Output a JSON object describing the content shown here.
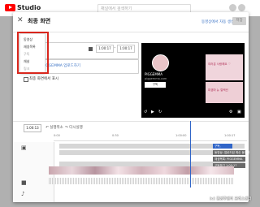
{
  "app": {
    "studio_label": "Studio",
    "search_placeholder": "채널에서 검색하기"
  },
  "modal": {
    "title": "최종 화면",
    "link_label": "동영상에서 자동 생성",
    "save_label": "저장"
  },
  "editor": {
    "row_number": "21",
    "start_time": "1:00:17",
    "end_time": "1:00:17",
    "caption_placeholder": "구독, PIGGEMMA 업로드하기",
    "checkbox_label": "최종 화면에서 표시"
  },
  "dropdown": {
    "items": [
      "동영상",
      "재생목록",
      "구독",
      "채널",
      "링크"
    ]
  },
  "preview": {
    "channel_name": "PIGGEMMA",
    "channel_sub": "piggemma.com",
    "subscribe": "구독",
    "thumb1_title": "여러분 사랑해요 ♡",
    "thumb2_title": "피겜마 뉴 컬렉션"
  },
  "timeline": {
    "current_time": "1:00:13",
    "undo": "실행취소",
    "redo": "다시실행",
    "ticks": [
      "0:00",
      "0:30",
      "1:00:00",
      "1:00:17"
    ],
    "clips": {
      "blue": "구독, PIGGEMMA 업로드하기",
      "gray1": "동영상: 업로드된 최신 동영상",
      "gray2": "재생목록: PIGGEMMA",
      "gray3": "구독하기 1:00:17"
    }
  },
  "watermark": "(c) 김성주엔터 프레스센터"
}
